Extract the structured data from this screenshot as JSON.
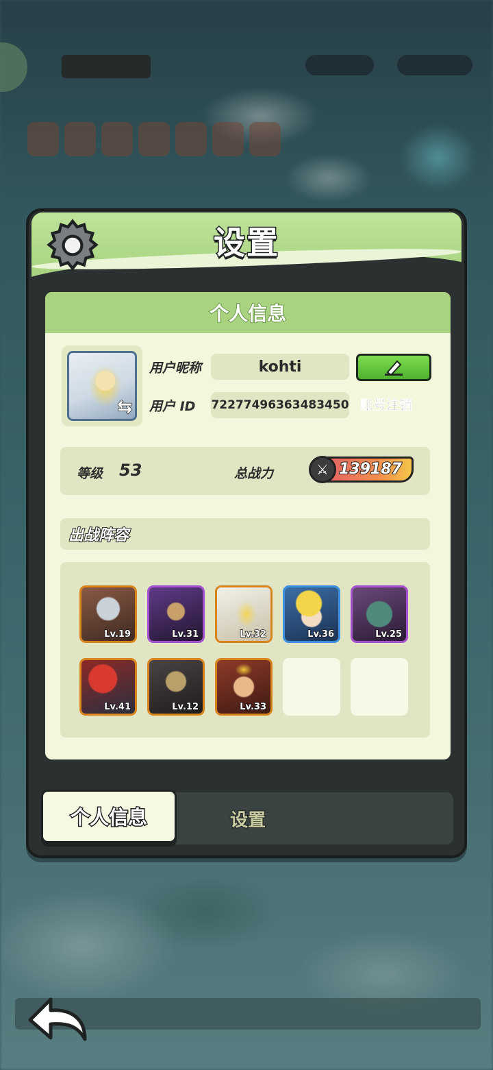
{
  "panel": {
    "title": "设置",
    "card_title": "个人信息"
  },
  "profile": {
    "nickname_label": "用户昵称",
    "nickname": "kohti",
    "id_label": "用户 ID",
    "user_id": "72277496363483450",
    "logout_label": "账号注销",
    "level_label": "等级",
    "level": "53",
    "power_label": "总战力",
    "power": "139187"
  },
  "lineup": {
    "title": "出战阵容",
    "heroes": [
      {
        "level": "Lv.19",
        "frame": "orange",
        "color": "#6a4a3e"
      },
      {
        "level": "Lv.31",
        "frame": "purple",
        "color": "#4a2f6a"
      },
      {
        "level": "Lv.32",
        "frame": "orange",
        "color": "#e6e0cf"
      },
      {
        "level": "Lv.36",
        "frame": "blue",
        "color": "#2f5f8f"
      },
      {
        "level": "Lv.25",
        "frame": "purple",
        "color": "#5a3b6b"
      },
      {
        "level": "Lv.41",
        "frame": "orange",
        "color": "#8a2a2a"
      },
      {
        "level": "Lv.12",
        "frame": "orange",
        "color": "#3a3535"
      },
      {
        "level": "Lv.33",
        "frame": "orange",
        "color": "#7a2d22"
      }
    ],
    "empty_slots": 2
  },
  "tabs": {
    "active": "个人信息",
    "inactive": "设置"
  },
  "colors": {
    "accent_green": "#a9d381",
    "card_bg": "#f3f7dc",
    "panel_dark": "#2b3131"
  },
  "icons": [
    "gear-icon",
    "swap-icon",
    "edit-icon",
    "sword-icon",
    "back-arrow-icon"
  ]
}
